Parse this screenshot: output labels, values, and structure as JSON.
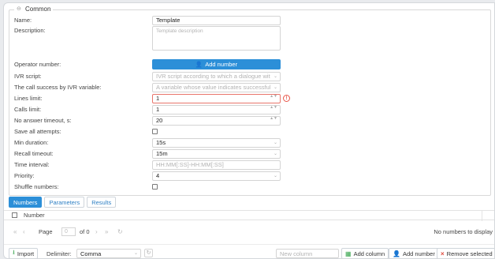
{
  "section": {
    "title": "Common"
  },
  "fields": {
    "name": {
      "label": "Name:",
      "value": "Template"
    },
    "description": {
      "label": "Description:",
      "placeholder": "Template description"
    },
    "operator": {
      "label": "Operator number:",
      "button": "Add number"
    },
    "ivr_script": {
      "label": "IVR script:",
      "placeholder": "IVR script according to which a dialogue wit"
    },
    "ivr_variable": {
      "label": "The call success by IVR variable:",
      "placeholder": "A variable whose value indicates successful"
    },
    "lines_limit": {
      "label": "Lines limit:",
      "value": "1"
    },
    "calls_limit": {
      "label": "Calls limit:",
      "value": "1"
    },
    "no_answer": {
      "label": "No answer timeout, s:",
      "value": "20"
    },
    "save_attempts": {
      "label": "Save all attempts:"
    },
    "min_duration": {
      "label": "Min duration:",
      "value": "15s"
    },
    "recall_timeout": {
      "label": "Recall timeout:",
      "value": "15m"
    },
    "time_interval": {
      "label": "Time interval:",
      "placeholder": "HH:MM[:SS]-HH:MM[:SS]"
    },
    "priority": {
      "label": "Priority:",
      "value": "4"
    },
    "shuffle": {
      "label": "Shuffle numbers:"
    }
  },
  "tabs": [
    "Numbers",
    "Parameters",
    "Results"
  ],
  "grid": {
    "column": "Number"
  },
  "pager": {
    "page_label": "Page",
    "page_value": "0",
    "of_label": "of 0",
    "status": "No numbers to display"
  },
  "toolbar": {
    "import": "Import",
    "delimiter_label": "Delimiter:",
    "delimiter_value": "Comma",
    "new_column_placeholder": "New column",
    "add_column": "Add column",
    "add_number": "Add number",
    "remove_selected": "Remove selected"
  },
  "colors": {
    "accent": "#2c8fd8",
    "error": "#e8574a",
    "green": "#3aa64f",
    "red": "#e04a3c"
  }
}
